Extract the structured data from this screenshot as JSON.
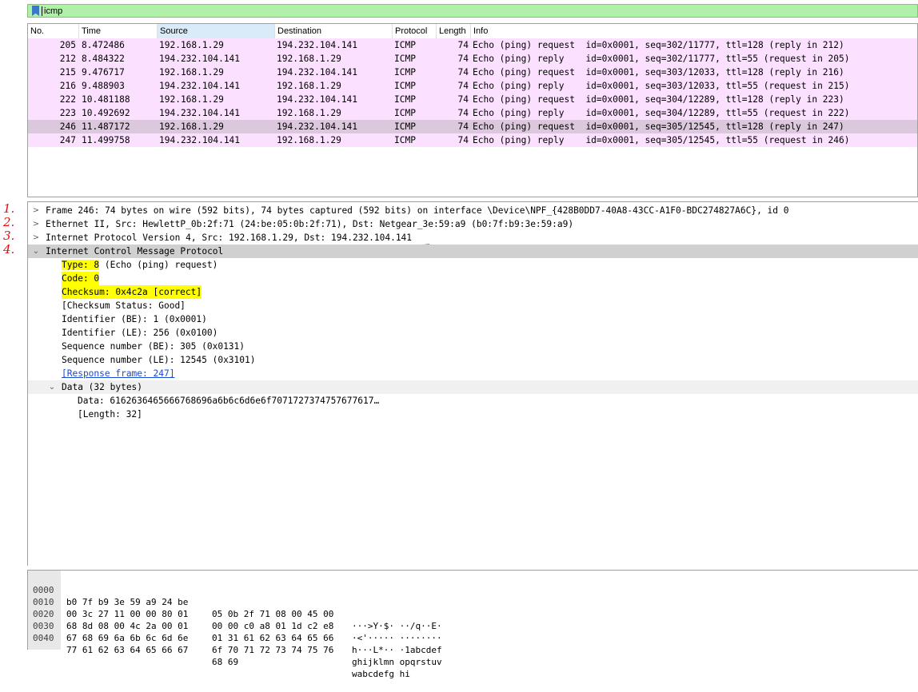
{
  "filter": {
    "value": "icmp"
  },
  "packet_list": {
    "columns": [
      "No.",
      "Time",
      "Source",
      "Destination",
      "Protocol",
      "Length",
      "Info"
    ],
    "rows": [
      {
        "no": "205",
        "time": "8.472486",
        "src": "192.168.1.29",
        "dst": "194.232.104.141",
        "proto": "ICMP",
        "len": "74",
        "info": "Echo (ping) request  id=0x0001, seq=302/11777, ttl=128 (reply in 212)"
      },
      {
        "no": "212",
        "time": "8.484322",
        "src": "194.232.104.141",
        "dst": "192.168.1.29",
        "proto": "ICMP",
        "len": "74",
        "info": "Echo (ping) reply    id=0x0001, seq=302/11777, ttl=55 (request in 205)"
      },
      {
        "no": "215",
        "time": "9.476717",
        "src": "192.168.1.29",
        "dst": "194.232.104.141",
        "proto": "ICMP",
        "len": "74",
        "info": "Echo (ping) request  id=0x0001, seq=303/12033, ttl=128 (reply in 216)"
      },
      {
        "no": "216",
        "time": "9.488903",
        "src": "194.232.104.141",
        "dst": "192.168.1.29",
        "proto": "ICMP",
        "len": "74",
        "info": "Echo (ping) reply    id=0x0001, seq=303/12033, ttl=55 (request in 215)"
      },
      {
        "no": "222",
        "time": "10.481188",
        "src": "192.168.1.29",
        "dst": "194.232.104.141",
        "proto": "ICMP",
        "len": "74",
        "info": "Echo (ping) request  id=0x0001, seq=304/12289, ttl=128 (reply in 223)"
      },
      {
        "no": "223",
        "time": "10.492692",
        "src": "194.232.104.141",
        "dst": "192.168.1.29",
        "proto": "ICMP",
        "len": "74",
        "info": "Echo (ping) reply    id=0x0001, seq=304/12289, ttl=55 (request in 222)"
      },
      {
        "no": "246",
        "time": "11.487172",
        "src": "192.168.1.29",
        "dst": "194.232.104.141",
        "proto": "ICMP",
        "len": "74",
        "info": "Echo (ping) request  id=0x0001, seq=305/12545, ttl=128 (reply in 247)"
      },
      {
        "no": "247",
        "time": "11.499758",
        "src": "194.232.104.141",
        "dst": "192.168.1.29",
        "proto": "ICMP",
        "len": "74",
        "info": "Echo (ping) reply    id=0x0001, seq=305/12545, ttl=55 (request in 246)"
      }
    ]
  },
  "details": {
    "frame": "Frame 246: 74 bytes on wire (592 bits), 74 bytes captured (592 bits) on interface \\Device\\NPF_{428B0DD7-40A8-43CC-A1F0-BDC274827A6C}, id 0",
    "ethernet": "Ethernet II, Src: HewlettP_0b:2f:71 (24:be:05:0b:2f:71), Dst: Netgear_3e:59:a9 (b0:7f:b9:3e:59:a9)",
    "ip_prefix": "Internet Protocol Version 4, Src: ",
    "ip_src": "192.168.1.29",
    "ip_mid": ", Dst: ",
    "ip_dst": "194.232.104.141",
    "icmp": "Internet Control Message Protocol",
    "type_hl": "Type: 8",
    "type_rest": " (Echo (ping) request)",
    "code": "Code: 0",
    "checksum": "Checksum: 0x4c2a [correct]",
    "checksum_status": "[Checksum Status: Good]",
    "id_be": "Identifier (BE): 1 (0x0001)",
    "id_le": "Identifier (LE): 256 (0x0100)",
    "seq_be": "Sequence number (BE): 305 (0x0131)",
    "seq_le": "Sequence number (LE): 12545 (0x3101)",
    "response_frame": "[Response frame: 247]",
    "data": "Data (32 bytes)",
    "data_value": "Data: 6162636465666768696a6b6c6d6e6f7071727374757677617…",
    "data_length": "[Length: 32]"
  },
  "annotations": [
    "1.",
    "2.",
    "3.",
    "4."
  ],
  "annotation_color": "#e01010",
  "highlight_color": "#ffff00",
  "bytes": [
    {
      "off": "0000",
      "hex1": "b0 7f b9 3e 59 a9 24 be",
      "hex2": "05 0b 2f 71 08 00 45 00",
      "ascii": "···>Y·$· ··/q··E·"
    },
    {
      "off": "0010",
      "hex1": "00 3c 27 11 00 00 80 01",
      "hex2": "00 00 c0 a8 01 1d c2 e8",
      "ascii": "·<'····· ········"
    },
    {
      "off": "0020",
      "hex1": "68 8d 08 00 4c 2a 00 01",
      "hex2": "01 31 61 62 63 64 65 66",
      "ascii": "h···L*·· ·1abcdef"
    },
    {
      "off": "0030",
      "hex1": "67 68 69 6a 6b 6c 6d 6e",
      "hex2": "6f 70 71 72 73 74 75 76",
      "ascii": "ghijklmn opqrstuv"
    },
    {
      "off": "0040",
      "hex1": "77 61 62 63 64 65 66 67",
      "hex2": "68 69",
      "ascii": "wabcdefg hi"
    }
  ]
}
